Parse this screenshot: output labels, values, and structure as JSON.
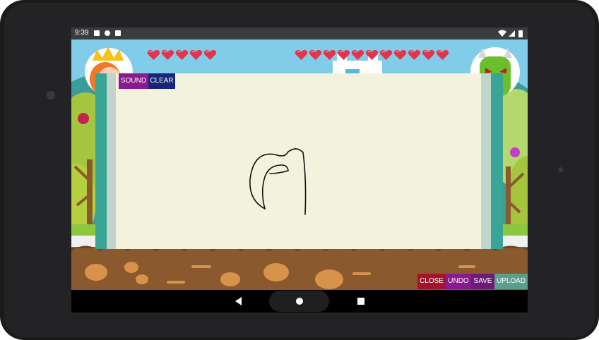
{
  "status_bar": {
    "time": "9:39"
  },
  "toolbar": {
    "sound_label": "SOUND",
    "clear_label": "CLEAR"
  },
  "bottom_bar": {
    "close_label": "CLOSE",
    "undo_label": "UNDO",
    "save_label": "SAVE",
    "upload_label": "UPLOAD"
  },
  "players": {
    "princess": {
      "hearts": 5
    },
    "monster": {
      "hearts": 11
    }
  },
  "colors": {
    "sound": "#8a1a8f",
    "clear": "#172678",
    "close": "#a3132b",
    "undo": "#8a1a8f",
    "save": "#6f1a7a",
    "upload": "#5a9e8b",
    "heart": "#e0354d",
    "board_paper": "#f3f2dd",
    "scroll": "#3aa595",
    "sky": "#81cde9",
    "ground": "#8a5a2e"
  },
  "icons": [
    "back-icon",
    "home-icon",
    "recents-icon",
    "wifi-icon",
    "signal-icon",
    "battery-icon",
    "crown-icon",
    "monster-icon"
  ]
}
